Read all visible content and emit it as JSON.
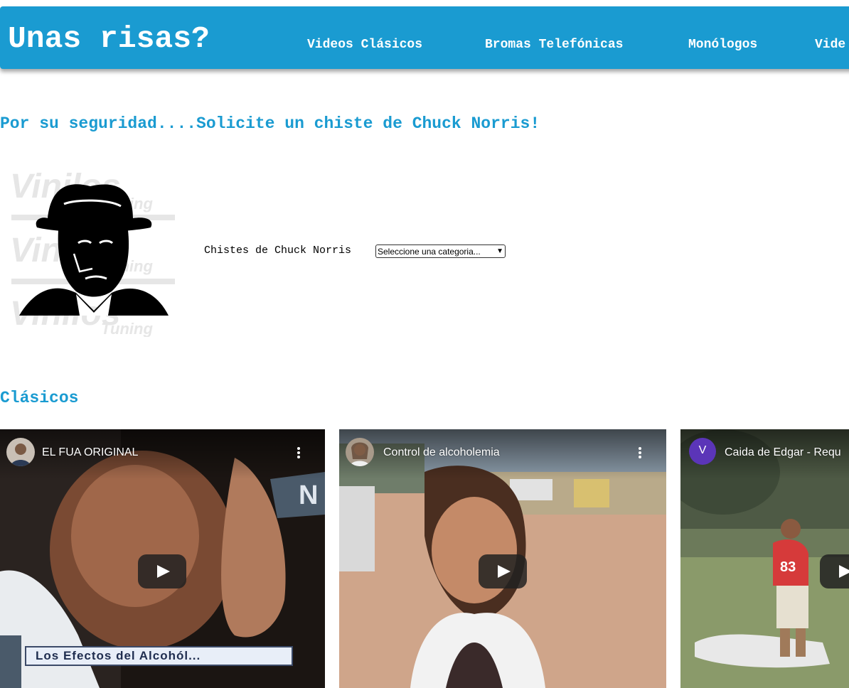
{
  "header": {
    "title": "Unas risas?",
    "nav": [
      "Videos Clásicos",
      "Bromas Telefónicas",
      "Monólogos",
      "Vide"
    ]
  },
  "chuck_section": {
    "heading": "Por su seguridad....Solicite un chiste de Chuck Norris!",
    "label": "Chistes de Chuck Norris",
    "select_value": "Seleccione una categoria...",
    "image_watermark": "Vinilos Tuning"
  },
  "classics": {
    "heading": "Clásicos",
    "videos": [
      {
        "title": "EL FUA ORIGINAL",
        "caption": "Los Efectos del Alcohól...",
        "avatar_letter": ""
      },
      {
        "title": "Control de alcoholemia",
        "caption": "",
        "avatar_letter": ""
      },
      {
        "title": "Caida de Edgar - Requ",
        "caption": "",
        "avatar_letter": "V"
      }
    ]
  },
  "colors": {
    "accent": "#1a9bd1",
    "header_text": "#ffffff"
  }
}
